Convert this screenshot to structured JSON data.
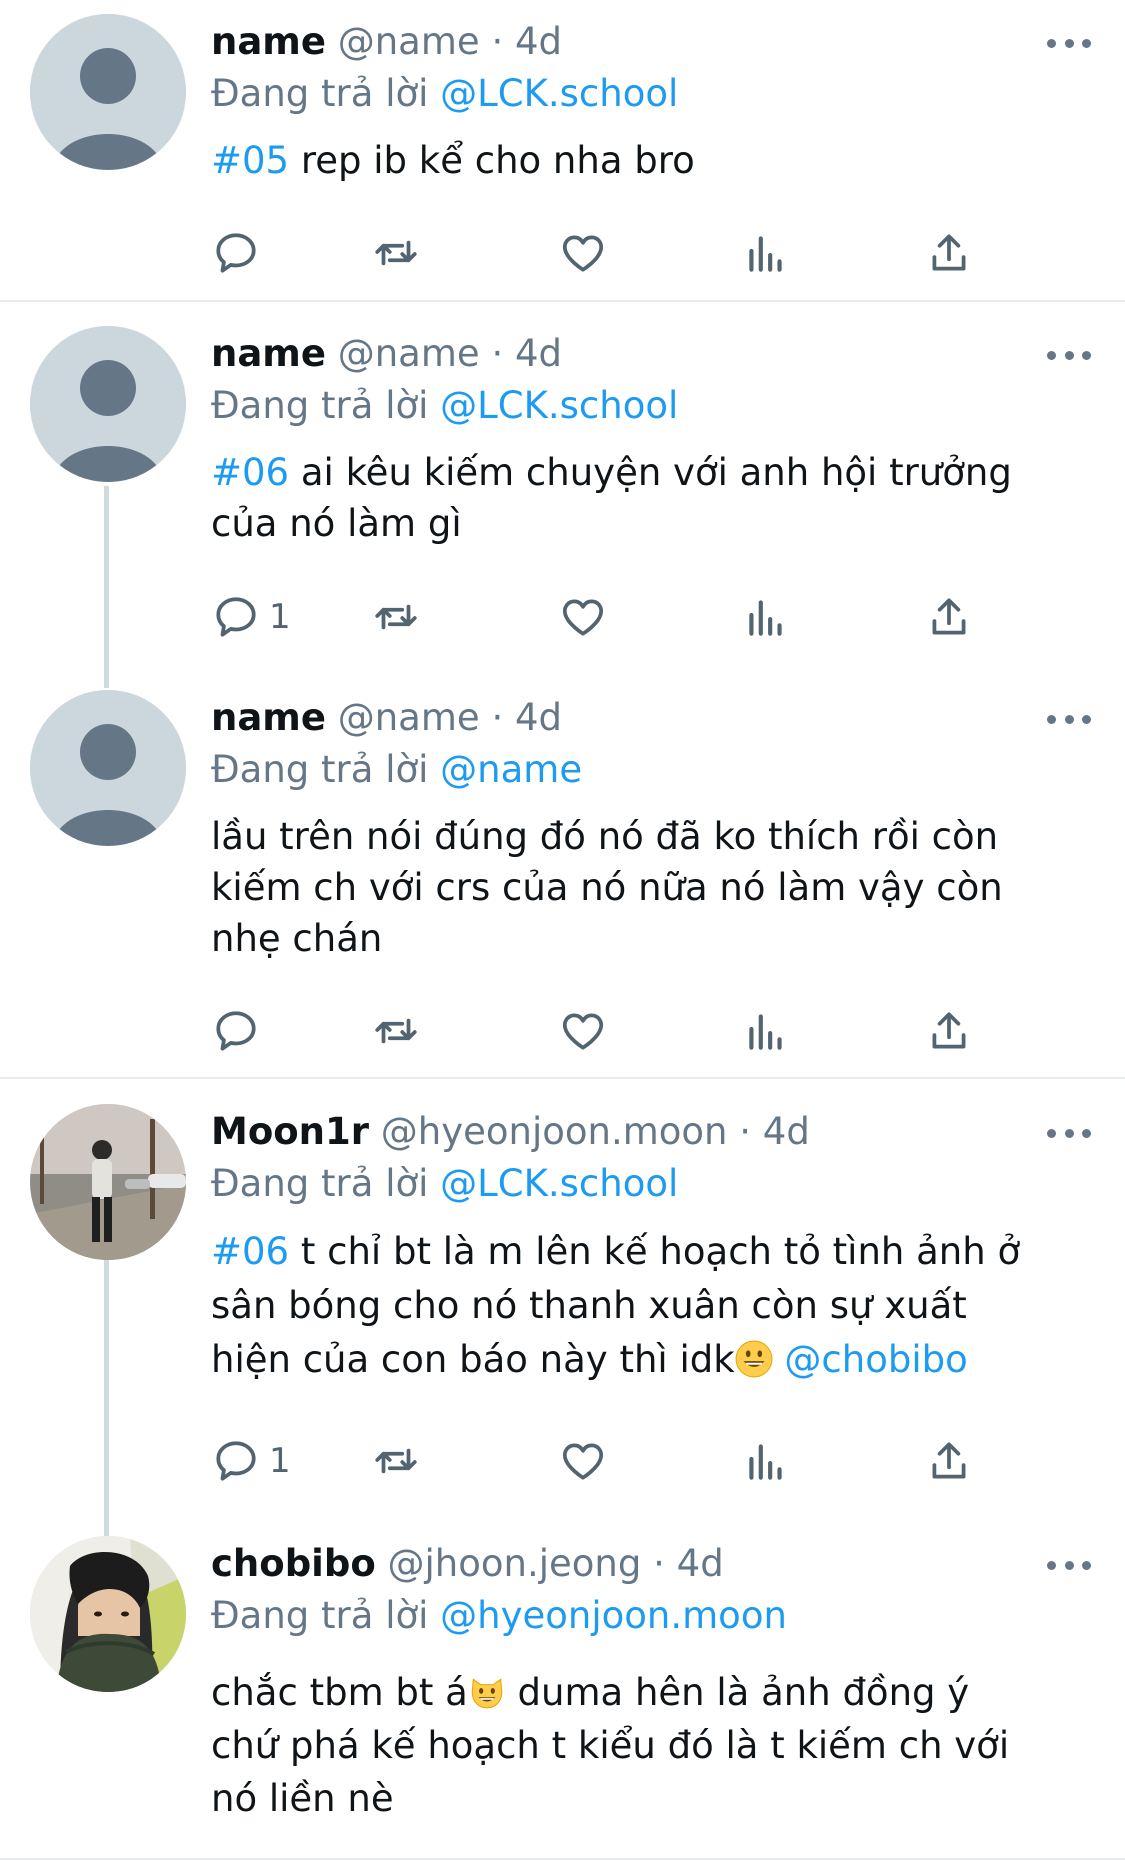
{
  "reply_prefix": "Đang trả lời",
  "separator": "·",
  "tweets": [
    {
      "name": "name",
      "handle": "@name",
      "time": "4d",
      "reply_to": "@LCK.school",
      "hashtag": "#05",
      "text": " rep ib kể cho nha bro",
      "reply_count": ""
    },
    {
      "name": "name",
      "handle": "@name",
      "time": "4d",
      "reply_to": "@LCK.school",
      "hashtag": "#06",
      "text": " ai kêu kiếm chuyện với anh hội trưởng của nó làm gì",
      "reply_count": "1"
    },
    {
      "name": "name",
      "handle": "@name",
      "time": "4d",
      "reply_to": "@name",
      "text": "lầu trên nói đúng đó nó đã ko thích rồi còn kiếm ch với crs của nó nữa nó làm vậy còn nhẹ chán",
      "reply_count": ""
    },
    {
      "name": "Moon1r",
      "handle": "@hyeonjoon.moon",
      "time": "4d",
      "reply_to": "@LCK.school",
      "hashtag": "#06",
      "text": " t chỉ bt là m lên kế hoạch tỏ tình ảnh ở sân bóng cho nó thanh xuân còn sự xuất hiện của con báo này thì idk",
      "mention": " @chobibo",
      "reply_count": "1"
    },
    {
      "name": "chobibo",
      "handle": "@jhoon.jeong",
      "time": "4d",
      "reply_to": "@hyeonjoon.moon",
      "text_a": "chắc tbm bt á",
      "text_b": " duma hên là ảnh đồng ý chứ phá kế hoạch t kiểu đó là t kiếm ch với nó liền nè"
    }
  ]
}
